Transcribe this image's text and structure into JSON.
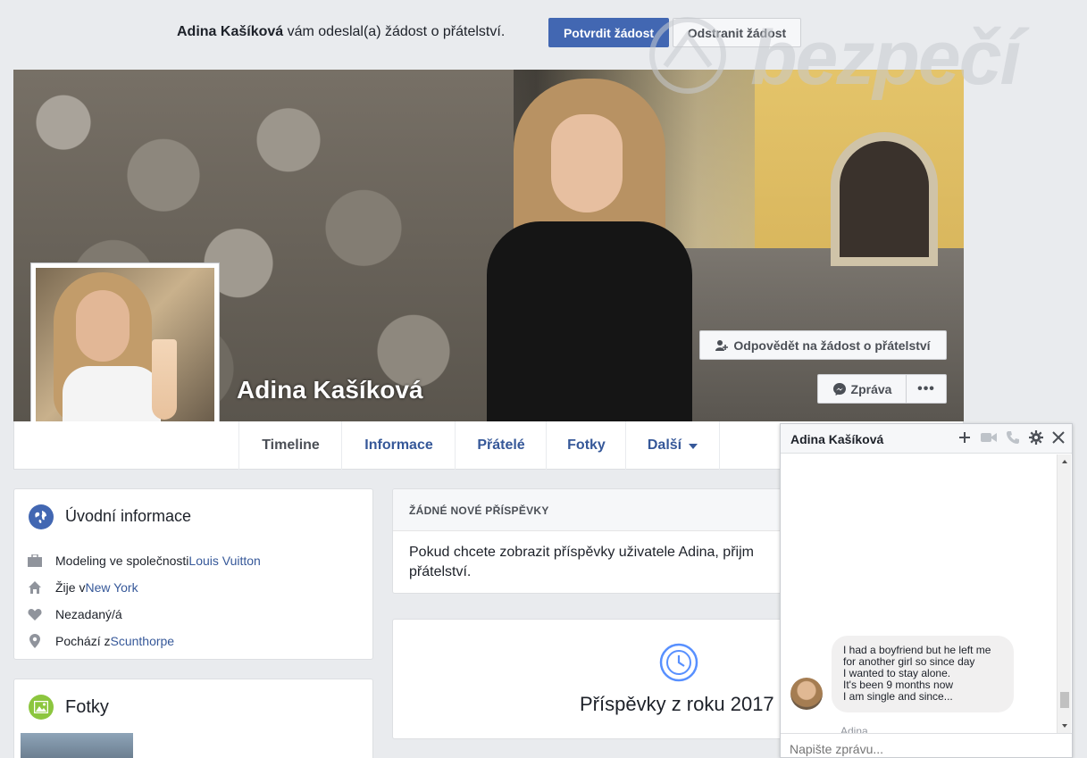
{
  "request_bar": {
    "sender_name": "Adina Kašíková",
    "message": " vám odeslal(a) žádost o přátelství.",
    "confirm_label": "Potvrdit žádost",
    "remove_label": "Odstranit žádost"
  },
  "watermark": {
    "text": "bezpečí"
  },
  "cover": {
    "name": "Adina Kašíková",
    "respond_label": "Odpovědět na žádost o přátelství",
    "message_label": "Zpráva",
    "more_label": "•••"
  },
  "nav": {
    "tabs": [
      {
        "label": "Timeline"
      },
      {
        "label": "Informace"
      },
      {
        "label": "Přátelé"
      },
      {
        "label": "Fotky"
      },
      {
        "label": "Další"
      }
    ]
  },
  "intro": {
    "title": "Úvodní informace",
    "items": [
      {
        "prefix": "Modeling ve společnosti ",
        "link": "Louis Vuitton"
      },
      {
        "prefix": "Žije v ",
        "link": "New York"
      },
      {
        "prefix": "Nezadaný/á",
        "link": ""
      },
      {
        "prefix": "Pochází z ",
        "link": "Scunthorpe"
      }
    ]
  },
  "photos": {
    "title": "Fotky"
  },
  "posts": {
    "header": "ŽÁDNÉ NOVÉ PŘÍSPĚVKY",
    "text": "Pokud chcete zobrazit příspěvky uživatele Adina, přijm přátelství.",
    "year_label": "Příspěvky z roku 2017"
  },
  "chat": {
    "name": "Adina Kašíková",
    "message_lines": [
      "I had a boyfriend but he left me",
      "for another girl so since day",
      "I wanted to stay alone.",
      "It's been 9 months now",
      "I am single and since..."
    ],
    "sender": "Adina",
    "input_placeholder": "Napište zprávu..."
  },
  "colors": {
    "brand": "#4267b2",
    "link": "#365899",
    "background": "#e9ebee"
  }
}
